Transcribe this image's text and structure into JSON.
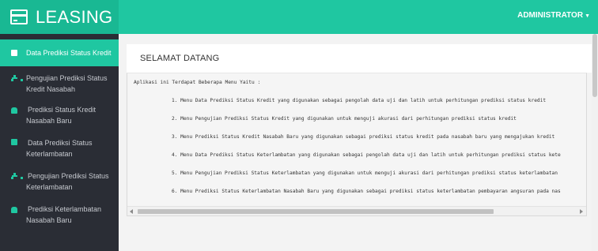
{
  "header": {
    "app_title": "LEASING",
    "user_menu": "ADMINISTRATOR",
    "brand_icon": "credit-card-icon",
    "colors": {
      "topbar": "#1fc7a1",
      "brand": "#19b893",
      "sidebar": "#2a2d35"
    }
  },
  "sidebar": {
    "items": [
      {
        "lines": [
          "Data Prediksi Status Kredit"
        ],
        "icon": "square-icon",
        "active": true
      },
      {
        "lines": [
          "Pengujian Prediksi Status",
          "Kredit Nasabah"
        ],
        "icon": "sitemap-icon",
        "active": false
      },
      {
        "lines": [
          "Prediksi Status Kredit",
          "Nasabah Baru"
        ],
        "icon": "car-icon",
        "active": false
      },
      {
        "lines": [
          "Data Prediksi Status",
          "Keterlambatan"
        ],
        "icon": "square-icon",
        "active": false
      },
      {
        "lines": [
          "Pengujian Prediksi Status",
          "Keterlambatan"
        ],
        "icon": "sitemap-icon",
        "active": false
      },
      {
        "lines": [
          "Prediksi Keterlambatan",
          "Nasabah Baru"
        ],
        "icon": "car-icon",
        "active": false
      }
    ]
  },
  "main": {
    "title": "SELAMAT DATANG",
    "intro": "Aplikasi ini Terdapat Beberapa Menu Yaitu :",
    "menu_lines": [
      "1. Menu Data Prediksi Status Kredit yang digunakan sebagai pengolah data uji dan latih untuk perhitungan prediksi status kredit",
      "2. Menu Pengujian Prediksi Status Kredit yang digunakan untuk menguji akurasi dari perhitungan prediksi status kredit",
      "3. Menu Prediksi Status Kredit Nasabah Baru yang digunakan sebagai prediksi status kredit pada nasabah baru yang mengajukan kredit",
      "4. Menu Data Prediksi Status Keterlambatan yang digunakan sebagai pengolah data uji dan latih untuk perhitungan prediksi status kete",
      "5. Menu Pengujian Prediksi Status Keterlambatan yang digunakan untuk menguji akurasi dari perhitungan prediksi status keterlambatan",
      "6. Menu Prediksi Status Keterlambatan Nasabah Baru yang digunakan sebagai prediksi status keterlambatan pembayaran angsuran pada nas"
    ]
  }
}
